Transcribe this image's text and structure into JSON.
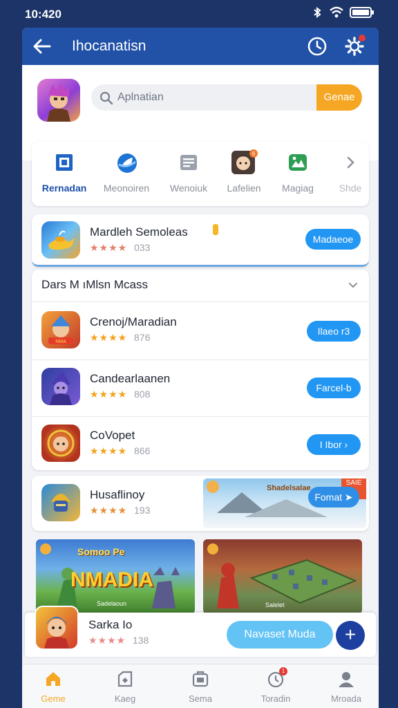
{
  "status_bar": {
    "time": "10:420"
  },
  "app_bar": {
    "title": "Ihocanatisn"
  },
  "search": {
    "placeholder": "Aplnatian",
    "button_label": "Genae"
  },
  "categories": [
    {
      "label": "Rernadan",
      "icon": "square-frame-icon",
      "active": true
    },
    {
      "label": "Meonoiren",
      "icon": "globe-icon",
      "active": false
    },
    {
      "label": "Wenoiuk",
      "icon": "list-icon",
      "active": false
    },
    {
      "label": "Lafelien",
      "icon": "character-avatar-icon",
      "active": false
    },
    {
      "label": "Magiag",
      "icon": "map-icon",
      "active": false
    },
    {
      "label": "Shde",
      "icon": "chevron-right-icon",
      "active": false
    }
  ],
  "featured": {
    "name": "Mardleh Semoleas",
    "stars": "★★★★",
    "rating_count": "033",
    "button_label": "Madaeoe"
  },
  "list_section": {
    "title": "Dars M ıMlsn Mcass",
    "items": [
      {
        "name": "Crenoj/Maradian",
        "stars": "★★★★",
        "rating_count": "876",
        "button_label": "Ilaeo r3"
      },
      {
        "name": "Candearlaanen",
        "stars": "★★★★",
        "rating_count": "808",
        "button_label": "Farcel-b"
      },
      {
        "name": "CoVopet",
        "stars": "★★★★",
        "rating_count": "866",
        "button_label": "I Ibor ›"
      }
    ]
  },
  "promo": {
    "name": "Husaflinoy",
    "stars": "★★★★",
    "rating_count": "193",
    "button_label": "Fomat ➤",
    "banner_tag": "Shadelsalae",
    "badge": "SAIE"
  },
  "tiles": [
    {
      "title": "Somoo Pe",
      "big": "NMADIA",
      "sub": "Sadelaoun"
    },
    {
      "title": "",
      "big": "",
      "sub": "Salelet"
    }
  ],
  "bottom_card": {
    "name": "Sarka Io",
    "stars": "★★★★",
    "rating_count": "138",
    "button_label": "Navaset Muda",
    "fab_label": "+"
  },
  "nav": [
    {
      "label": "Geme",
      "icon": "home-icon",
      "active": true
    },
    {
      "label": "Kaeg",
      "icon": "bag-icon",
      "active": false
    },
    {
      "label": "Sema",
      "icon": "box-icon",
      "active": false
    },
    {
      "label": "Toradin",
      "icon": "notification-icon",
      "active": false,
      "badge": "1"
    },
    {
      "label": "Mroada",
      "icon": "profile-icon",
      "active": false
    }
  ],
  "colors": {
    "primary": "#2152a8",
    "accent": "#f5a623",
    "button": "#2196f3"
  }
}
